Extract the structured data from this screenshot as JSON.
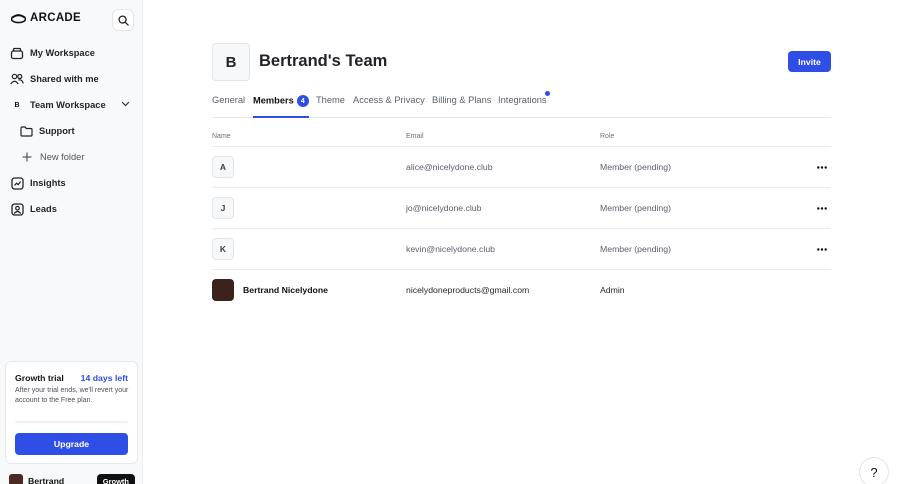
{
  "brand": {
    "name": "ARCADE",
    "icon": "arcade-logo-icon"
  },
  "sidebar": {
    "search_icon": "search-icon",
    "items": [
      {
        "label": "My Workspace",
        "icon": "workspace-icon"
      },
      {
        "label": "Shared with me",
        "icon": "users-icon"
      },
      {
        "label": "Team Workspace",
        "badge": "B",
        "icon": "chevron-down-icon"
      },
      {
        "label": "Support",
        "icon": "folder-icon"
      },
      {
        "label": "New folder",
        "icon": "plus-icon"
      },
      {
        "label": "Insights",
        "icon": "insights-icon"
      },
      {
        "label": "Leads",
        "icon": "leads-icon"
      }
    ],
    "trial": {
      "title": "Growth trial",
      "days_left": "14 days left",
      "description": "After your trial ends, we'll revert your account to the Free plan.",
      "upgrade_label": "Upgrade"
    },
    "user": {
      "name": "Bertrand",
      "plan": "Growth"
    }
  },
  "team": {
    "initial": "B",
    "name": "Bertrand's Team",
    "invite_label": "Invite"
  },
  "tabs": [
    {
      "label": "General"
    },
    {
      "label": "Members",
      "count": "4",
      "active": true
    },
    {
      "label": "Theme"
    },
    {
      "label": "Access & Privacy"
    },
    {
      "label": "Billing & Plans"
    },
    {
      "label": "Integrations",
      "dot": true
    }
  ],
  "table": {
    "headers": {
      "name": "Name",
      "email": "Email",
      "role": "Role"
    },
    "rows": [
      {
        "initial": "A",
        "name": "",
        "email": "alice@nicelydone.club",
        "role": "Member (pending)"
      },
      {
        "initial": "J",
        "name": "",
        "email": "jo@nicelydone.club",
        "role": "Member (pending)"
      },
      {
        "initial": "K",
        "name": "",
        "email": "kevin@nicelydone.club",
        "role": "Member (pending)"
      },
      {
        "initial": "",
        "name": "Bertrand Nicelydone",
        "email": "nicelydoneproducts@gmail.com",
        "role": "Admin"
      }
    ]
  },
  "help": {
    "label": "?"
  },
  "colors": {
    "accent": "#2f4ee6",
    "sidebar_bg": "#f8f9fb"
  }
}
